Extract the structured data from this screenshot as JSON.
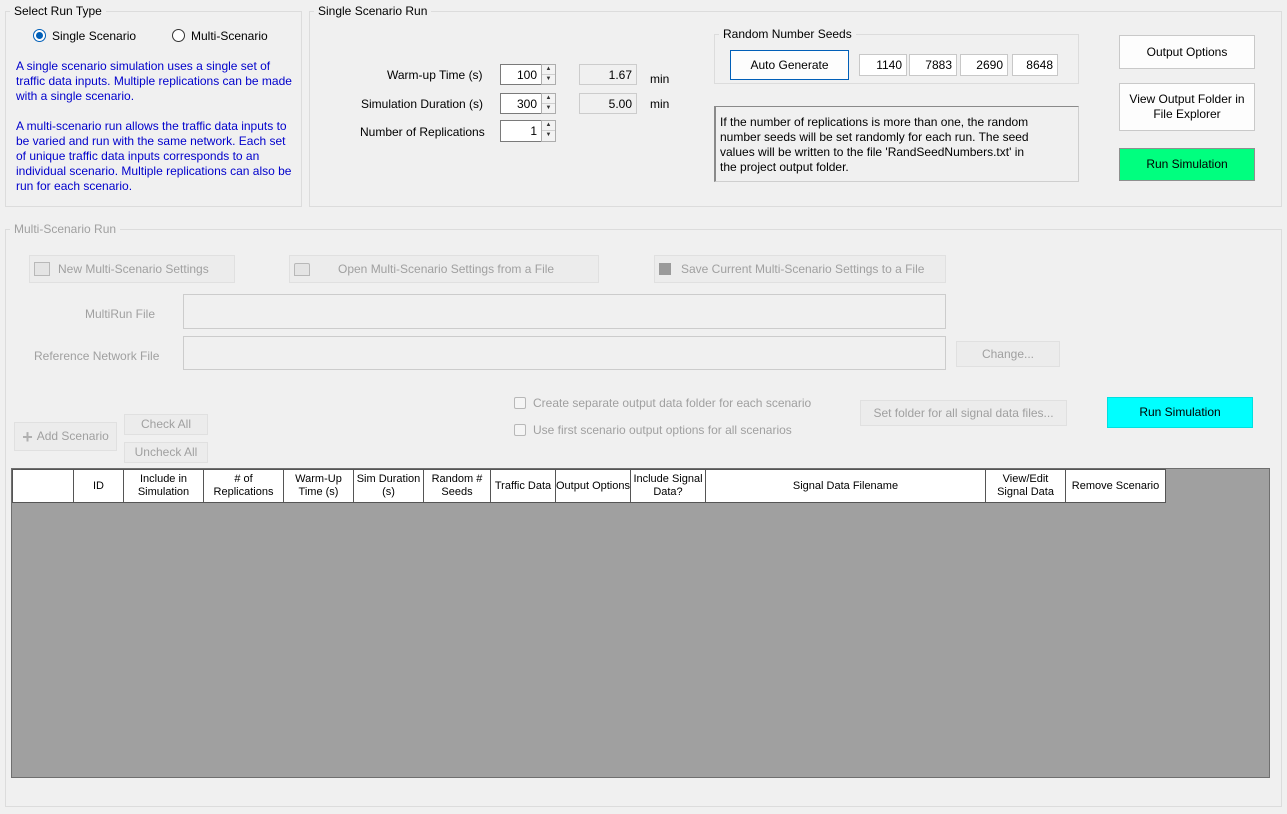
{
  "run_type": {
    "legend": "Select Run Type",
    "single_label": "Single Scenario",
    "multi_label": "Multi-Scenario",
    "selected": "single",
    "desc1": "A single scenario simulation uses a single set of traffic data inputs. Multiple replications can be made with a single scenario.",
    "desc2": "A multi-scenario run allows the traffic data inputs to be varied and run with the same network. Each set of unique traffic data inputs corresponds to an individual scenario. Multiple replications can also be run for each scenario."
  },
  "single_run": {
    "legend": "Single Scenario Run",
    "warmup_label": "Warm-up Time (s)",
    "warmup_value": "100",
    "warmup_min": "1.67",
    "duration_label": "Simulation Duration (s)",
    "duration_value": "300",
    "duration_min": "5.00",
    "min_unit": "min",
    "replications_label": "Number of Replications",
    "replications_value": "1",
    "seeds": {
      "legend": "Random Number Seeds",
      "auto_label": "Auto Generate",
      "values": [
        "1140",
        "7883",
        "2690",
        "8648"
      ]
    },
    "note": "If the number of replications is more than one, the random number seeds will be set randomly for each run.  The seed values will be written to the file 'RandSeedNumbers.txt' in the project output folder.",
    "output_options": "Output Options",
    "view_output_folder": "View Output Folder in File Explorer",
    "run_simulation": "Run Simulation"
  },
  "multi_run": {
    "legend": "Multi-Scenario Run",
    "new_settings": "New Multi-Scenario Settings",
    "open_settings": "Open Multi-Scenario Settings from a File",
    "save_settings": "Save Current Multi-Scenario Settings to a File",
    "multirun_label": "MultiRun File",
    "multirun_value": "",
    "refnet_label": "Reference Network File",
    "refnet_value": "",
    "change": "Change...",
    "add_scenario": "Add Scenario",
    "check_all": "Check All",
    "uncheck_all": "Uncheck All",
    "sep_folder": "Create separate output data folder for each scenario",
    "first_output": "Use first scenario output options for all scenarios",
    "set_folder": "Set folder for all signal data files...",
    "run_simulation": "Run Simulation",
    "columns": [
      "",
      "ID",
      "Include in Simulation",
      "# of Replications",
      "Warm-Up Time (s)",
      "Sim Duration (s)",
      "Random # Seeds",
      "Traffic Data",
      "Output Options",
      "Include Signal Data?",
      "Signal Data Filename",
      "View/Edit Signal Data",
      "Remove Scenario"
    ]
  },
  "colors": {
    "run_green": "#00ff7f",
    "run_cyan": "#00ffff",
    "desc_blue": "#0000cc",
    "grid_bg": "#a0a0a0"
  }
}
